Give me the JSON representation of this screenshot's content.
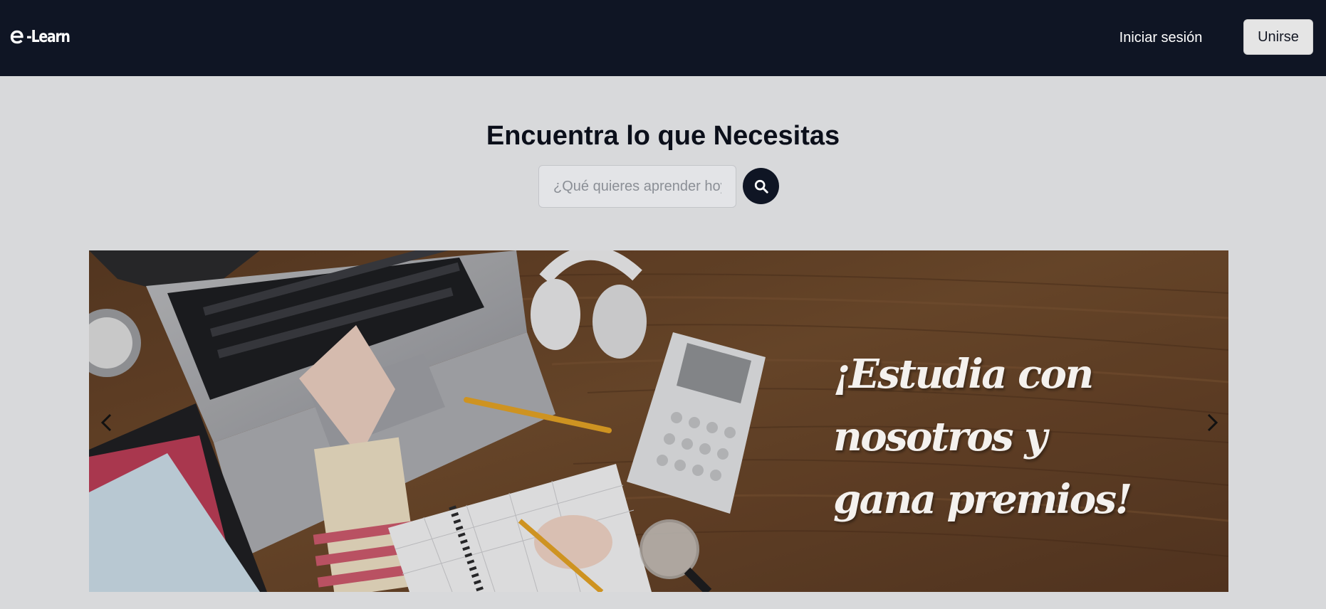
{
  "navbar": {
    "logo_text": "-Learn",
    "logo_icon": "e-letter-logo-icon",
    "login_label": "Iniciar sesión",
    "join_label": "Unirse",
    "background": "#0f1524"
  },
  "search": {
    "headline": "Encuentra lo que Necesitas",
    "placeholder": "¿Qué quieres aprender hoy?",
    "button_icon": "search-icon"
  },
  "carousel": {
    "slide_caption_lines": [
      "¡Estudia con",
      "nosotros y",
      "gana premios!"
    ],
    "prev_icon": "chevron-left-icon",
    "next_icon": "chevron-right-icon"
  },
  "colors": {
    "page_background": "#d8d9db",
    "accent_dark": "#0f1524",
    "join_button": "#e5e5e5"
  }
}
